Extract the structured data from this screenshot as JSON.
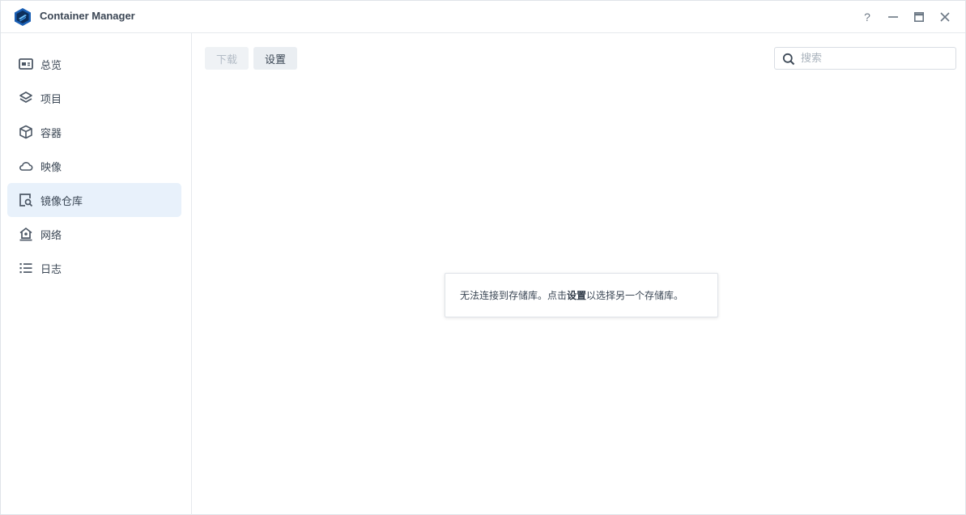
{
  "app": {
    "title": "Container Manager",
    "accent": "#1f6fd1"
  },
  "window_controls": [
    {
      "name": "help-icon",
      "label": "?"
    },
    {
      "name": "minimize-icon"
    },
    {
      "name": "maximize-icon"
    },
    {
      "name": "close-icon"
    }
  ],
  "sidebar": {
    "items": [
      {
        "label": "总览",
        "icon": "overview-icon",
        "active": false
      },
      {
        "label": "项目",
        "icon": "layers-icon",
        "active": false
      },
      {
        "label": "容器",
        "icon": "cube-icon",
        "active": false
      },
      {
        "label": "映像",
        "icon": "cloud-icon",
        "active": false
      },
      {
        "label": "镜像仓库",
        "icon": "registry-search-icon",
        "active": true
      },
      {
        "label": "网络",
        "icon": "network-icon",
        "active": false
      },
      {
        "label": "日志",
        "icon": "list-icon",
        "active": false
      }
    ],
    "active_bg": "#e8f1fb"
  },
  "toolbar": {
    "download_label": "下载",
    "download_disabled": true,
    "settings_label": "设置"
  },
  "search": {
    "placeholder": "搜索",
    "value": ""
  },
  "message": {
    "before": "无法连接到存储库。点击",
    "strong": "设置",
    "after": "以选择另一个存储库。"
  }
}
